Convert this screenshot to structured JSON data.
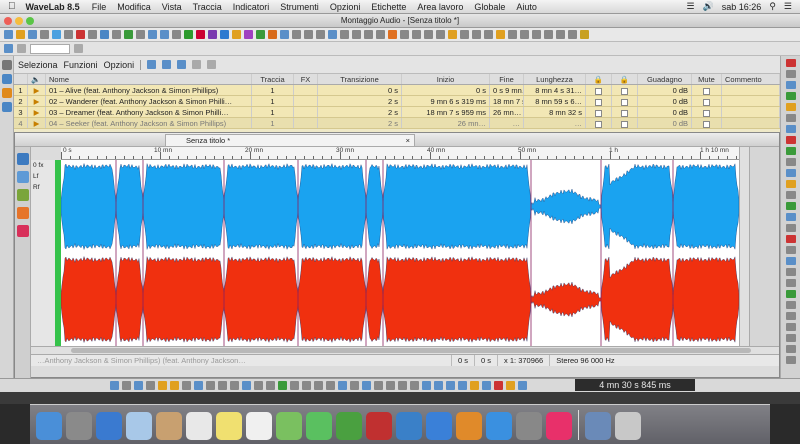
{
  "menubar": {
    "app_name": "WaveLab 8.5",
    "items": [
      "File",
      "Modifica",
      "Vista",
      "Traccia",
      "Indicatori",
      "Strumenti",
      "Opzioni",
      "Etichette",
      "Area lavoro",
      "Globale",
      "Aiuto"
    ],
    "clock": "sab 16:26",
    "apple_icon": "apple-icon"
  },
  "window": {
    "title": "Montaggio Audio - [Senza titolo *]"
  },
  "montage": {
    "menu": [
      "Seleziona",
      "Funzioni",
      "Opzioni"
    ],
    "columns": [
      "Nome",
      "Traccia",
      "FX",
      "Transizione",
      "Inizio",
      "Fine",
      "Lunghezza",
      "",
      "",
      "Guadagno",
      "Mute",
      "Commento"
    ],
    "rows": [
      {
        "num": "1",
        "name": "01 – Alive (feat. Anthony Jackson & Simon Phillips)",
        "track": "1",
        "transition": "0 s",
        "start": "0 s",
        "end": "0 s  9 mn…",
        "length": "8 mn 4 s 31…",
        "gain": "0 dB"
      },
      {
        "num": "2",
        "name": "02 – Wanderer (feat. Anthony Jackson & Simon Philli…",
        "track": "1",
        "transition": "2 s",
        "start": "9 mn 6 s 319 ms",
        "end": "18 mn 7 s…",
        "length": "8 mn 59 s 6…",
        "gain": "0 dB"
      },
      {
        "num": "3",
        "name": "03 – Dreamer (feat. Anthony Jackson & Simon Philli…",
        "track": "1",
        "transition": "2 s",
        "start": "18 mn 7 s 959 ms",
        "end": "26 mn…",
        "length": "8 mn 32 s",
        "gain": "0 dB"
      },
      {
        "num": "4",
        "name": "04 – Seeker (feat. Anthony Jackson & Simon Phillips)",
        "track": "1",
        "transition": "2 s",
        "start": "26 mn…",
        "end": "…",
        "length": "…",
        "gain": "0 dB"
      }
    ]
  },
  "wave_window": {
    "tab_title": "Senza titolo *",
    "ruler": [
      "0 s",
      "10 mn",
      "20 mn",
      "30 mn",
      "40 mn",
      "50 mn",
      "1 h",
      "1 h 10 mn"
    ],
    "channel_labels": [
      "0 fx",
      "Lf",
      "Rf"
    ],
    "channel_colors": {
      "left": "#1aa3f0",
      "right": "#f0300f"
    }
  },
  "status": {
    "ghost_text": "…Anthony Jackson & Simon Phillips) (feat. Anthony Jackson…",
    "field1": "0 s",
    "field2": "0 s",
    "ratio": "x 1: 370966",
    "format": "Stereo 96 000 Hz"
  },
  "transport": {
    "time": "4 mn 30 s 845 ms"
  },
  "dock": {
    "icons": [
      "finder-icon",
      "launchpad-icon",
      "safari-icon",
      "mail-icon",
      "contacts-icon",
      "calendar-icon",
      "notes-icon",
      "reminders-icon",
      "maps-icon",
      "messages-icon",
      "facetime-icon",
      "photo-booth-icon",
      "iphoto-icon",
      "itunes-icon",
      "ibooks-icon",
      "app-store-icon",
      "system-preferences-icon",
      "wavelab-icon",
      "downloads-icon",
      "trash-icon"
    ]
  }
}
